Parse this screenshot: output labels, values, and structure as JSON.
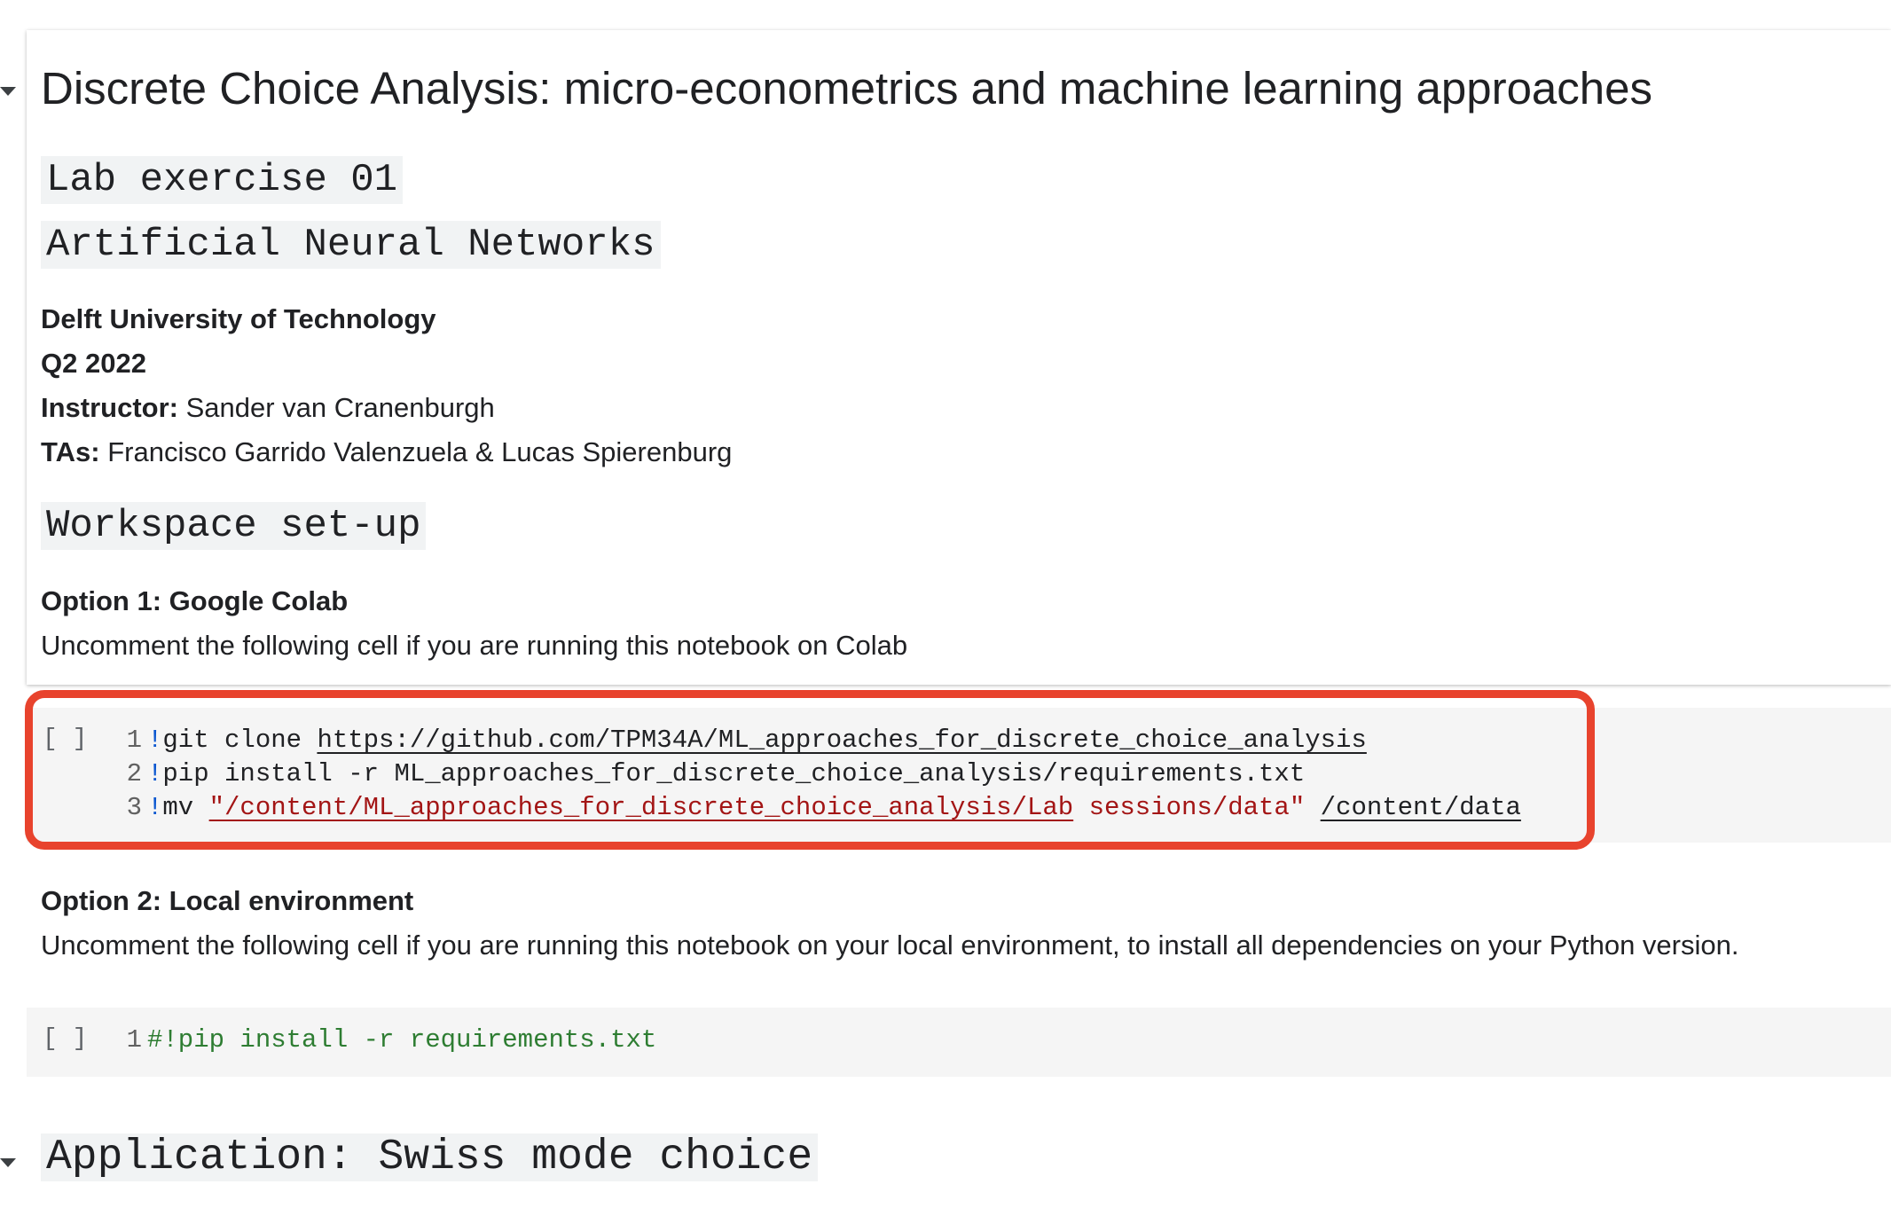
{
  "notebook": {
    "title": "Discrete Choice Analysis: micro-econometrics and machine learning approaches",
    "lab_heading": "Lab exercise 01",
    "topic_heading": "Artificial Neural Networks",
    "university": "Delft University of Technology",
    "term": "Q2 2022",
    "instructor_label": "Instructor:",
    "instructor_name": " Sander van Cranenburgh",
    "tas_label": "TAs:",
    "tas_names": " Francisco Garrido Valenzuela & Lucas Spierenburg",
    "workspace_heading": "Workspace set-up",
    "option1_title": "Option 1: Google Colab",
    "option1_text": "Uncomment the following cell if you are running this notebook on Colab",
    "option2_title": "Option 2: Local environment",
    "option2_text": "Uncomment the following cell if you are running this notebook on your local environment, to install all dependencies on your Python version.",
    "application_heading": "Application: Swiss mode choice"
  },
  "code_cell_1": {
    "run_bracket": "[ ]",
    "lines": [
      {
        "no": "1",
        "bang": "!",
        "cmd": "git clone ",
        "url": "https://github.com/TPM34A/ML_approaches_for_discrete_choice_analysis"
      },
      {
        "no": "2",
        "bang": "!",
        "cmd": "pip install -r ML_approaches_for_discrete_choice_analysis/requirements.txt"
      },
      {
        "no": "3",
        "bang": "!",
        "cmd": "mv ",
        "str_underlined": "\"/content/ML_approaches_for_discrete_choice_analysis/Lab",
        "str_rest": " sessions/data\"",
        "space": " ",
        "dest": "/content/data"
      }
    ]
  },
  "code_cell_2": {
    "run_bracket": "[ ]",
    "lines": [
      {
        "no": "1",
        "comment": "#!pip install -r requirements.txt"
      }
    ]
  },
  "colors": {
    "highlight": "#e8432d",
    "code_background": "#f5f5f5",
    "string": "#a31515",
    "comment": "#2e7d32"
  }
}
